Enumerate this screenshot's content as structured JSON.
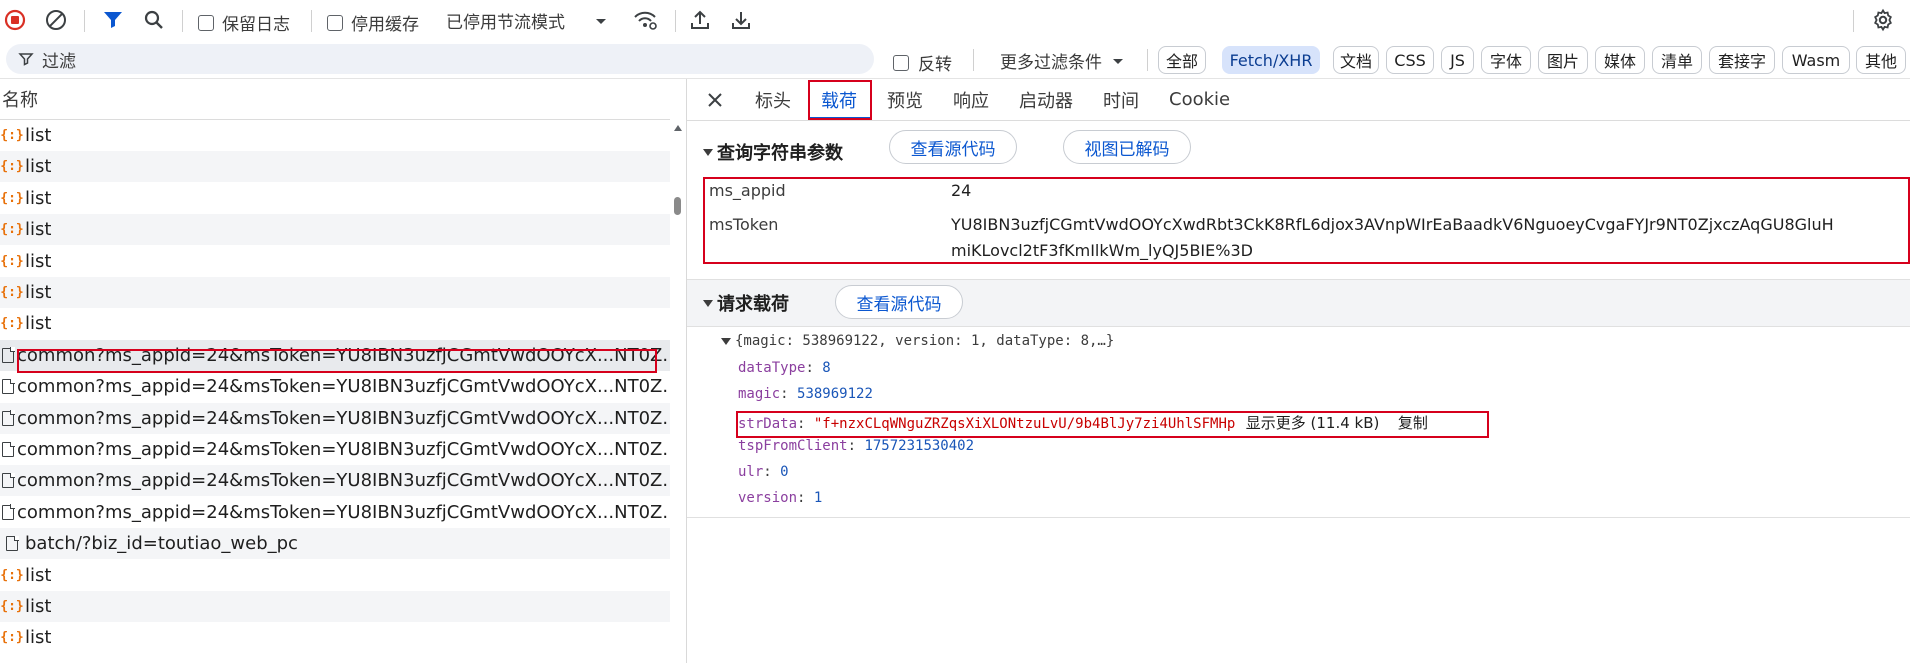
{
  "toolbar": {
    "preserve_log": "保留日志",
    "disable_cache": "停用缓存",
    "throttle": "已停用节流模式"
  },
  "filterbar": {
    "filter_placeholder": "过滤",
    "invert": "反转",
    "more_filters": "更多过滤条件",
    "chips": [
      "全部",
      "Fetch/XHR",
      "文档",
      "CSS",
      "JS",
      "字体",
      "图片",
      "媒体",
      "清单",
      "套接字",
      "Wasm",
      "其他"
    ],
    "active_chip": "Fetch/XHR"
  },
  "requests": {
    "column_name": "名称",
    "rows": [
      {
        "type": "xhr",
        "name": "list"
      },
      {
        "type": "xhr",
        "name": "list"
      },
      {
        "type": "xhr",
        "name": "list"
      },
      {
        "type": "xhr",
        "name": "list"
      },
      {
        "type": "xhr",
        "name": "list"
      },
      {
        "type": "xhr",
        "name": "list"
      },
      {
        "type": "xhr",
        "name": "list"
      },
      {
        "type": "doc",
        "name": "common?ms_appid=24&msToken=YU8IBN3uzfjCGmtVwdOOYcX...NT0Z..."
      },
      {
        "type": "doc",
        "name": "common?ms_appid=24&msToken=YU8IBN3uzfjCGmtVwdOOYcX...NT0Z..."
      },
      {
        "type": "doc",
        "name": "common?ms_appid=24&msToken=YU8IBN3uzfjCGmtVwdOOYcX...NT0Z..."
      },
      {
        "type": "doc",
        "name": "common?ms_appid=24&msToken=YU8IBN3uzfjCGmtVwdOOYcX...NT0Z..."
      },
      {
        "type": "doc",
        "name": "common?ms_appid=24&msToken=YU8IBN3uzfjCGmtVwdOOYcX...NT0Z..."
      },
      {
        "type": "doc",
        "name": "common?ms_appid=24&msToken=YU8IBN3uzfjCGmtVwdOOYcX...NT0Z..."
      },
      {
        "type": "doc",
        "name": "batch/?biz_id=toutiao_web_pc"
      },
      {
        "type": "xhr",
        "name": "list"
      },
      {
        "type": "xhr",
        "name": "list"
      },
      {
        "type": "xhr",
        "name": "list"
      }
    ]
  },
  "detail": {
    "tabs": [
      "标头",
      "载荷",
      "预览",
      "响应",
      "启动器",
      "时间",
      "Cookie"
    ],
    "active_tab": "载荷",
    "query": {
      "title": "查询字符串参数",
      "view_source": "查看源代码",
      "view_decoded": "视图已解码",
      "params": [
        {
          "key": "ms_appid",
          "value": "24"
        },
        {
          "key": "msToken",
          "value_line1": "YU8IBN3uzfjCGmtVwdOOYcXwdRbt3CkK8RfL6djox3AVnpWIrEaBaadkV6NguoeyCvgaFYJr9NT0ZjxczAqGU8GluH",
          "value_line2": "miKLovcl2tF3fKmIlkWm_lyQJ5BIE%3D"
        }
      ]
    },
    "payload": {
      "title": "请求载荷",
      "view_source": "查看源代码",
      "summary": "{magic: 538969122, version: 1, dataType: 8,…}",
      "fields": [
        {
          "key": "dataType",
          "value": "8"
        },
        {
          "key": "magic",
          "value": "538969122"
        },
        {
          "key": "strData",
          "value": "\"f+nzxCLqWNguZRZqsXiXLONtzuLvU/9b4BlJy7zi4UhlSFMHp",
          "more": "显示更多 (11.4 kB)",
          "copy": "复制"
        },
        {
          "key": "tspFromClient",
          "value": "1757231530402"
        },
        {
          "key": "ulr",
          "value": "0"
        },
        {
          "key": "version",
          "value": "1"
        }
      ]
    }
  },
  "colors": {
    "accent": "#0b57d0",
    "highlight": "#d6001c",
    "record": "#d93025",
    "xhr_icon": "#e8710a"
  }
}
